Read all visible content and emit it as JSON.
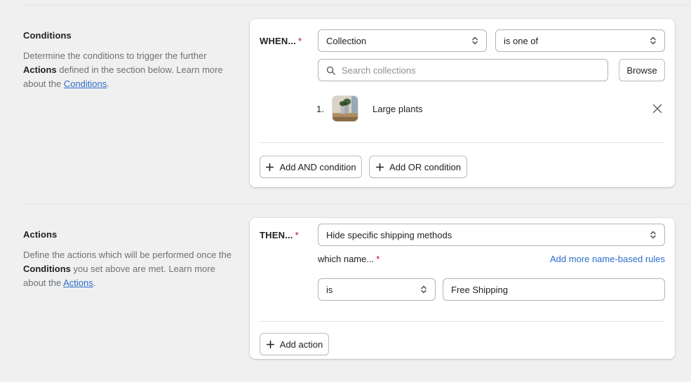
{
  "theme": {
    "page_bg": "#f0f0f0",
    "card_bg": "#ffffff",
    "border": "#aeb4b9",
    "divider": "#e1e3e5",
    "text": "#202223",
    "subdued_text": "#6d7175",
    "link": "#2c6ecb",
    "required_asterisk": "#bf0711"
  },
  "sections": {
    "conditions": {
      "title": "Conditions",
      "description_parts": {
        "p1": "Determine the conditions to trigger the further ",
        "b1": "Actions",
        "p2": " defined in the section below. Learn more about the ",
        "link": "Conditions",
        "p3": "."
      },
      "row": {
        "label": "WHEN...",
        "required_mark": "*",
        "subject_select": "Collection",
        "operator_select": "is one of"
      },
      "search": {
        "placeholder": "Search collections",
        "icon": "search-icon"
      },
      "browse_button": "Browse",
      "selected_collections": [
        {
          "index": "1.",
          "name": "Large plants",
          "thumbnail": "plant-photo-thumbnail",
          "remove_icon": "close-icon"
        }
      ],
      "footer_buttons": [
        {
          "label": "Add AND condition",
          "icon": "plus-icon"
        },
        {
          "label": "Add OR condition",
          "icon": "plus-icon"
        }
      ]
    },
    "actions": {
      "title": "Actions",
      "description_parts": {
        "p1": "Define the actions which will be performed once the ",
        "b1": "Conditions",
        "p2": " you set above are met. Learn more about the ",
        "link": "Actions",
        "p3": "."
      },
      "row": {
        "label": "THEN...",
        "required_mark": "*",
        "action_select": "Hide specific shipping methods"
      },
      "name_rule": {
        "label": "which name...",
        "required_mark": "*",
        "add_more_link": "Add more name-based rules",
        "operator_select": "is",
        "value_input": "Free Shipping"
      },
      "footer_buttons": [
        {
          "label": "Add action",
          "icon": "plus-icon"
        }
      ]
    }
  }
}
